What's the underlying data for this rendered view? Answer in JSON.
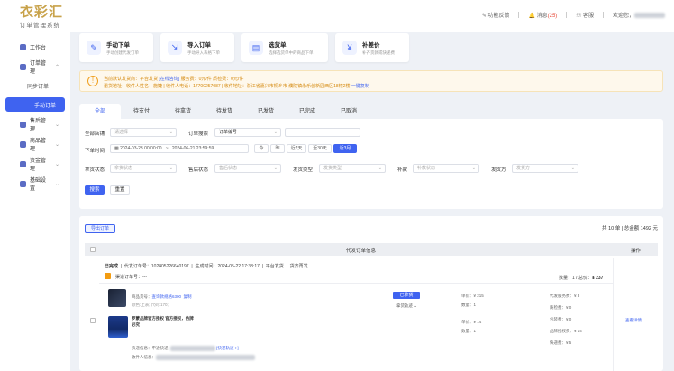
{
  "brand": {
    "logo_text": "衣彩汇",
    "subtitle": "订单管理系统"
  },
  "header": {
    "feedback": "功能反馈",
    "messages_label": "消息",
    "messages_count": "(25)",
    "service": "客服",
    "welcome": "欢迎您，"
  },
  "sidebar": {
    "items": [
      {
        "label": "工作台",
        "icon": "home-icon"
      },
      {
        "label": "订单管理",
        "icon": "order-icon"
      },
      {
        "label": "同步订单"
      },
      {
        "label": "手动订单"
      },
      {
        "label": "售后管理",
        "icon": "aftersale-icon"
      },
      {
        "label": "商品管理",
        "icon": "goods-icon"
      },
      {
        "label": "资金管理",
        "icon": "wallet-icon"
      },
      {
        "label": "基础设置",
        "icon": "settings-icon"
      }
    ]
  },
  "quick_cards": [
    {
      "title": "手动下单",
      "sub": "手动创建代发订单",
      "icon": "edit-icon"
    },
    {
      "title": "导入订单",
      "sub": "手动导入表格下单",
      "icon": "import-icon"
    },
    {
      "title": "选货单",
      "sub": "选择选货单中的商品下单",
      "icon": "cart-icon"
    },
    {
      "title": "补差价",
      "sub": "补齐货款或快递费",
      "icon": "money-icon"
    }
  ],
  "notice": {
    "line1_label": "当前默认发货商：",
    "line1_value": "平台发货",
    "line1_link": "[在线咨询]",
    "line1_rest": "服务费：0元/件  质检费：0元/件",
    "line2": "退货地址：收件人姓名：施婕 | 收件人电话：17700257087 | 收件地址：浙江省嘉兴市桐乡市 濮院镇永乐创新园西区18幢2楼",
    "line2_link": "一键复制"
  },
  "tabs": [
    "全部",
    "待支付",
    "待拿货",
    "待发货",
    "已发货",
    "已完成",
    "已取消"
  ],
  "filters": {
    "shop_label": "全部店铺",
    "shop_placeholder": "请选择",
    "search_label": "订单搜索",
    "search_type": "订单编号",
    "time_label": "下单时间",
    "time_start": "2024-03-23 00:00:00",
    "time_sep": "~",
    "time_end": "2024-06-21 23:59:59",
    "quick_ranges": [
      "今",
      "昨",
      "近7天",
      "近30天",
      "近3月"
    ],
    "quick_active": 4,
    "ship_status_label": "拿货状态",
    "ship_status_ph": "拿货状态",
    "after_label": "售后状态",
    "after_ph": "售后状态",
    "delivery_label": "发货类型",
    "delivery_ph": "发货类型",
    "quality_label": "补款",
    "quality_ph": "补款状态",
    "shipper_label": "发货方",
    "shipper_ph": "发货方",
    "search_btn": "搜索",
    "reset_btn": "重置"
  },
  "list": {
    "export_btn": "导出订单",
    "total": "共 10 单 | 总金额 1492 元",
    "head_main": "代发订单信息",
    "head_op": "操作",
    "order": {
      "status": "已完成",
      "no_label": "代发订单号：",
      "no": "102405226640197",
      "time_label": "生成时间：",
      "time": "2024-05-22 17:38:17",
      "platform": "平台发货",
      "sale_tag": "货齐再发",
      "channel_label": "渠道订单号：",
      "channel_no": "---",
      "qty_total": "数量：1 / 总价：",
      "price_total": "¥ 237",
      "goods_label": "商品货号：",
      "goods_no": "查询款规格6300",
      "copy": "复制",
      "spec": "颜色:上表; 尺码:170;",
      "brand_text": "罗蒙品牌官方授权 官方授权，仿牌",
      "brand_text2": "必究",
      "status_badge": "已拿货",
      "status_detail": "拿货轨迹 ⌄",
      "price1": "单价：¥ 215",
      "qty1": "数量：1",
      "price2": "单价：¥ 14",
      "qty2": "数量：1",
      "fee_goods": "代发服务费：¥ 3",
      "fee_check": "质检费：¥ 0",
      "fee_pack": "包装费：¥ 0",
      "fee_brand": "品牌授权费：¥ 14",
      "fee_ship": "快递费：¥ 5",
      "express_label": "快递信息：",
      "express_value": "申通快递",
      "express_link": "[快递轨迹 >]",
      "receiver_label": "收件人信息：",
      "view_detail": "查看详情"
    }
  },
  "colors": {
    "accent": "#3f63f0",
    "gold": "#c8a24a",
    "notice": "#d4870a"
  }
}
